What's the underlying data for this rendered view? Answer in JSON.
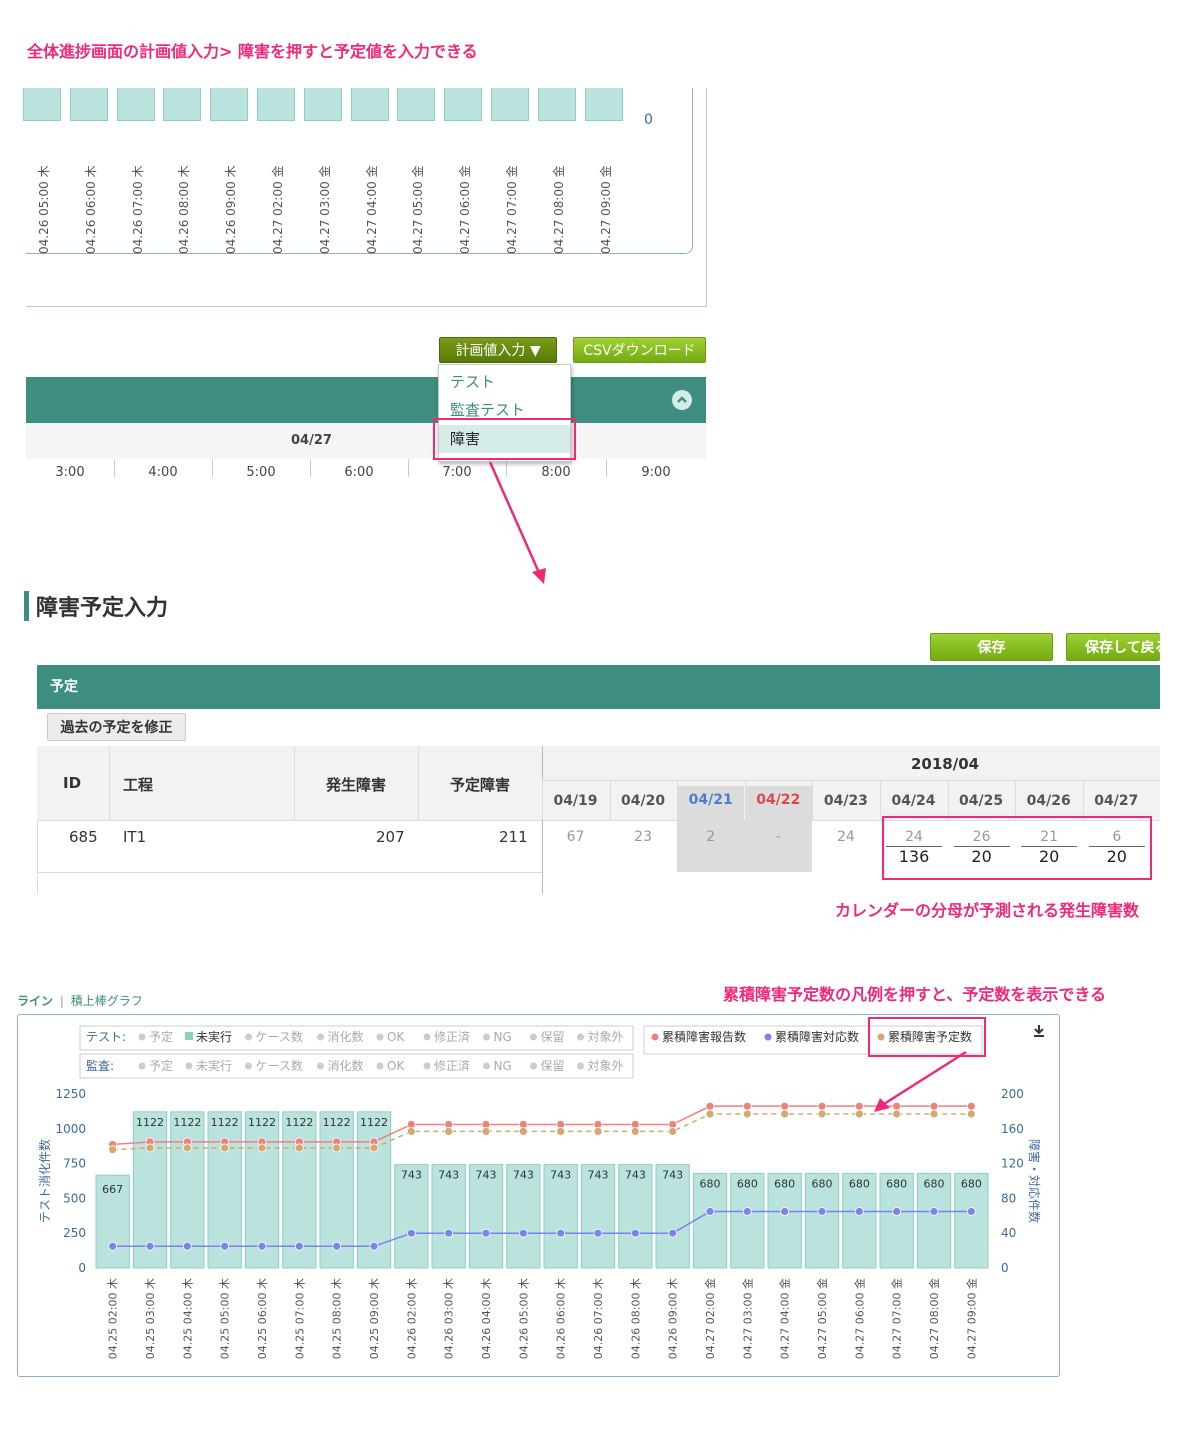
{
  "annotations": {
    "top_note": "全体進捗画面の計画値入力> 障害を押すと予定値を入力できる",
    "calendar_note": "カレンダーの分母が予測される発生障害数",
    "legend_note": "累積障害予定数の凡例を押すと、予定数を表示できる"
  },
  "top_chart": {
    "right_axis_zero": "0",
    "x_labels": [
      "04.26 05:00 木",
      "04.26 06:00 木",
      "04.26 07:00 木",
      "04.26 08:00 木",
      "04.26 09:00 木",
      "04.27 02:00 金",
      "04.27 03:00 金",
      "04.27 04:00 金",
      "04.27 05:00 金",
      "04.27 06:00 金",
      "04.27 07:00 金",
      "04.27 08:00 金",
      "04.27 09:00 金"
    ]
  },
  "toolbar": {
    "plan_input_label": "計画値入力 ▼",
    "csv_label": "CSVダウンロード"
  },
  "dropdown": {
    "items": [
      "テスト",
      "監査テスト",
      "障害"
    ]
  },
  "schedule_header": {
    "date": "04/27",
    "hours": [
      "3:00",
      "4:00",
      "5:00",
      "6:00",
      "7:00",
      "8:00",
      "9:00"
    ]
  },
  "form": {
    "title": "障害予定入力",
    "save_label": "保存",
    "save_back_label": "保存して戻る",
    "section_label": "予定",
    "past_button_label": "過去の予定を修正",
    "columns": {
      "id": "ID",
      "process": "工程",
      "occurred": "発生障害",
      "planned": "予定障害"
    },
    "month": "2018/04",
    "dates": [
      "04/19",
      "04/20",
      "04/21",
      "04/22",
      "04/23",
      "04/24",
      "04/25",
      "04/26",
      "04/27"
    ],
    "date_colors": [
      "#555555",
      "#555555",
      "#4a7fd0",
      "#e04848",
      "#555555",
      "#555555",
      "#555555",
      "#555555",
      "#555555"
    ],
    "row": {
      "id": "685",
      "process": "IT1",
      "occurred": "207",
      "planned": "211",
      "plain_values": [
        "67",
        "23",
        "2",
        "-",
        "24"
      ],
      "fractions": [
        {
          "num": "24",
          "den": "136"
        },
        {
          "num": "26",
          "den": "20"
        },
        {
          "num": "21",
          "den": "20"
        },
        {
          "num": "6",
          "den": "20"
        }
      ]
    }
  },
  "chart_tabs": {
    "line": "ライン",
    "separator": "|",
    "stacked": "積上棒グラフ"
  },
  "chart_data": {
    "type": "bar",
    "legend_rows": [
      {
        "label": "テスト:",
        "items": [
          "予定",
          "未実行",
          "ケース数",
          "消化数",
          "OK",
          "修正済",
          "NG",
          "保留",
          "対象外"
        ],
        "active": [
          false,
          true,
          false,
          false,
          false,
          false,
          false,
          false,
          false
        ]
      },
      {
        "label": "監査:",
        "items": [
          "予定",
          "未実行",
          "ケース数",
          "消化数",
          "OK",
          "修正済",
          "NG",
          "保留",
          "対象外"
        ],
        "active": [
          false,
          false,
          false,
          false,
          false,
          false,
          false,
          false,
          false
        ]
      }
    ],
    "legend_right": [
      {
        "name": "累積障害報告数",
        "color": "#f08080"
      },
      {
        "name": "累積障害対応数",
        "color": "#8080f0"
      },
      {
        "name": "累積障害予定数",
        "color": "#d4a870"
      }
    ],
    "categories": [
      "04.25 02:00 木",
      "04.25 03:00 木",
      "04.25 04:00 木",
      "04.25 05:00 木",
      "04.25 06:00 木",
      "04.25 07:00 木",
      "04.25 08:00 木",
      "04.25 09:00 木",
      "04.26 02:00 木",
      "04.26 03:00 木",
      "04.26 04:00 木",
      "04.26 05:00 木",
      "04.26 06:00 木",
      "04.26 07:00 木",
      "04.26 08:00 木",
      "04.26 09:00 木",
      "04.27 02:00 金",
      "04.27 03:00 金",
      "04.27 04:00 金",
      "04.27 05:00 金",
      "04.27 06:00 金",
      "04.27 07:00 金",
      "04.27 08:00 金",
      "04.27 09:00 金"
    ],
    "bars": {
      "name": "未実行",
      "color": "#b9e3dc",
      "values": [
        667,
        1122,
        1122,
        1122,
        1122,
        1122,
        1122,
        1122,
        743,
        743,
        743,
        743,
        743,
        743,
        743,
        743,
        680,
        680,
        680,
        680,
        680,
        680,
        680,
        680
      ]
    },
    "series": [
      {
        "name": "累積障害報告数",
        "axis": "right",
        "color": "#f07f7f",
        "dash": false,
        "values": [
          142,
          145,
          145,
          145,
          145,
          145,
          145,
          145,
          165,
          165,
          165,
          165,
          165,
          165,
          165,
          165,
          186,
          186,
          186,
          186,
          186,
          186,
          186,
          186
        ]
      },
      {
        "name": "累積障害予定数",
        "axis": "right",
        "color": "#d4a870",
        "dash": true,
        "values": [
          136,
          138,
          138,
          138,
          138,
          138,
          138,
          138,
          157,
          157,
          157,
          157,
          157,
          157,
          157,
          157,
          177,
          177,
          177,
          177,
          177,
          177,
          177,
          177
        ]
      },
      {
        "name": "累積障害対応数",
        "axis": "right",
        "color": "#8080f0",
        "dash": false,
        "values": [
          25,
          25,
          25,
          25,
          25,
          25,
          25,
          25,
          40,
          40,
          40,
          40,
          40,
          40,
          40,
          40,
          65,
          65,
          65,
          65,
          65,
          65,
          65,
          65
        ]
      }
    ],
    "ylabel": "テスト消化件数",
    "y2label": "障害・対応件数",
    "ylim": [
      0,
      1250
    ],
    "y2lim": [
      0,
      200
    ],
    "yticks": [
      "0",
      "250",
      "500",
      "750",
      "1000",
      "1250"
    ],
    "y2ticks": [
      "0",
      "40",
      "80",
      "120",
      "160",
      "200"
    ],
    "download_icon": "download-icon"
  }
}
